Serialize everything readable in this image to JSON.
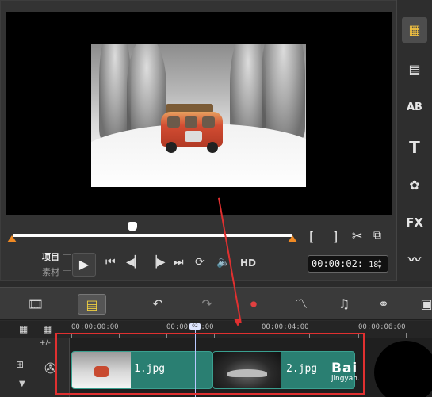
{
  "player": {
    "mode_project": "项目",
    "mode_clip": "素材",
    "hd_label": "HD",
    "timecode": "00:00:02",
    "timecode_frames": "18",
    "mark_in": "[",
    "mark_out": "]"
  },
  "right_toolbar": {
    "title_text": "AB",
    "fx_label": "FX"
  },
  "timeline_toolbar": {
    "add_track_label": "+/-"
  },
  "ruler": {
    "ticks": [
      "00:00:00:00",
      "00:00:02:00",
      "00:00:04:00",
      "00:00:06:00"
    ],
    "playhead_label": "02"
  },
  "clips": [
    {
      "name": "1.jpg"
    },
    {
      "name": "2.jpg"
    }
  ],
  "watermark": {
    "brand": "Bai",
    "domain": "jingyan."
  },
  "colors": {
    "clip_green": "#2a7f72",
    "trim_orange": "#f08a24",
    "annotation_red": "#e03030"
  }
}
